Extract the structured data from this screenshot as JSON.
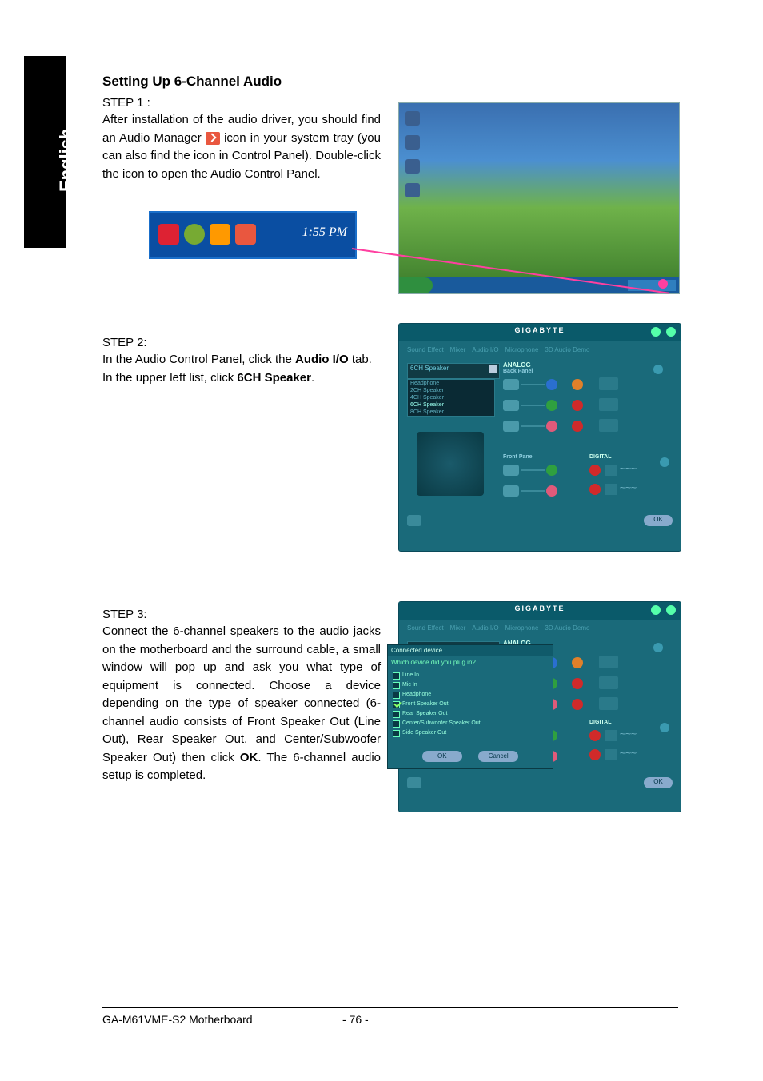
{
  "side_tab": "English",
  "section_title": "Setting Up 6-Channel Audio",
  "step1": {
    "label": "STEP 1 :",
    "text_before_icon": "After installation of the audio driver, you should find an Audio Manager",
    "text_after_icon": " icon in your system tray (you can also find the icon in Control Panel).  Double-click the icon to open the Audio Control Panel."
  },
  "systray_clock": "1:55 PM",
  "step2": {
    "label": "STEP 2:",
    "line1": "In the Audio Control Panel, click the ",
    "bold1": "Audio I/O",
    "after_bold1": " tab.",
    "line2_before": "In the upper left list, click ",
    "bold2": "6CH Speaker",
    "after_bold2": "."
  },
  "audio_panel": {
    "brand": "GIGABYTE",
    "tabs": [
      "Sound Effect",
      "Mixer",
      "Audio I/O",
      "Microphone",
      "3D Audio Demo"
    ],
    "active_tab": 2,
    "speaker_selected": "6CH Speaker",
    "dropdown": [
      "Headphone",
      "2CH Speaker",
      "4CH Speaker",
      "6CH Speaker",
      "8CH Speaker"
    ],
    "analog_label": "ANALOG",
    "back_panel_label": "Back Panel",
    "front_panel_label": "Front Panel",
    "digital_label": "DIGITAL",
    "ok": "OK"
  },
  "step3": {
    "label": "STEP 3:",
    "text_before_bold": "Connect the 6-channel speakers to the audio jacks on the motherboard and the surround cable, a small window will pop up and ask you what type of equipment is connected. Choose a device depending on the type of speaker connected (6-channel audio consists of Front Speaker Out (Line Out), Rear Speaker Out, and Center/Subwoofer Speaker Out) then click ",
    "bold": "OK",
    "text_after_bold": ". The 6-channel audio setup is completed."
  },
  "conn_popup": {
    "header": "Connected device :",
    "question": "Which device did you plug in?",
    "options": [
      {
        "label": "Line In",
        "checked": false
      },
      {
        "label": "Mic In",
        "checked": false
      },
      {
        "label": "Headphone",
        "checked": false
      },
      {
        "label": "Front Speaker Out",
        "checked": true
      },
      {
        "label": "Rear Speaker Out",
        "checked": false
      },
      {
        "label": "Center/Subwoofer Speaker Out",
        "checked": false
      },
      {
        "label": "Side Speaker Out",
        "checked": false
      }
    ],
    "ok": "OK",
    "cancel": "Cancel"
  },
  "footer": {
    "product": "GA-M61VME-S2 Motherboard",
    "page": "- 76 -"
  }
}
